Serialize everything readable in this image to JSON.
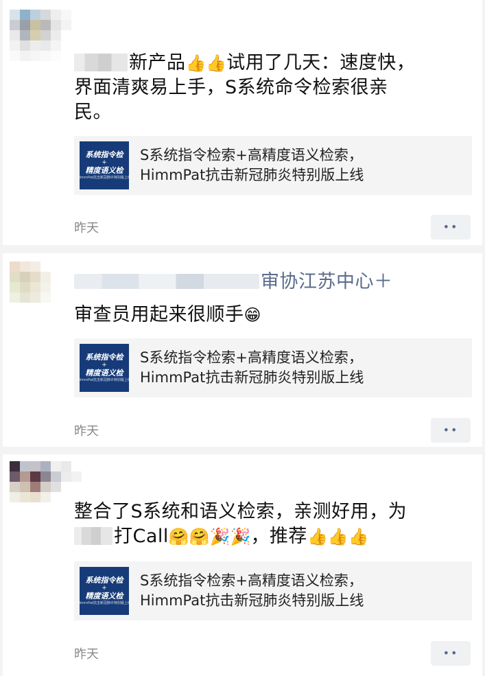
{
  "posts": [
    {
      "text_lines": [
        "新产品",
        "试用了几天：速度快，",
        "界面清爽易上手，S系统命令检索很亲",
        "民。"
      ],
      "emoji_line1": "👍👍",
      "link": {
        "line1": "S系统指令检索+高精度语义检索，",
        "line2": "HimmPat抗击新冠肺炎特别版上线"
      },
      "time": "昨天"
    },
    {
      "title_suffix": "审协江苏中心＋",
      "text": "审查员用起来很顺手",
      "emoji": "😁",
      "link": {
        "line1": "S系统指令检索+高精度语义检索，",
        "line2": "HimmPat抗击新冠肺炎特别版上线"
      },
      "time": "昨天"
    },
    {
      "line1": "整合了S系统和语义检索，亲测好用，为",
      "line2_a": "打Call",
      "line2_emoji": "🤗🤗🎉🎉",
      "line2_b": "，推荐",
      "line2_emoji2": "👍👍👍",
      "link": {
        "line1": "S系统指令检索+高精度语义检索，",
        "line2": "HimmPat抗击新冠肺炎特别版上线"
      },
      "time": "昨天"
    }
  ],
  "thumbnail": {
    "line1": "系统指令检",
    "line2": "+",
    "line3": "精度语义检",
    "line4": "HimmPat抗击新冠肺炎特别版上线"
  },
  "more_label": "••",
  "colors": {
    "thumb_bg": "#163b78",
    "link_title": "#5a6b8c",
    "card_bg": "#f4f4f4",
    "time": "#888888"
  }
}
